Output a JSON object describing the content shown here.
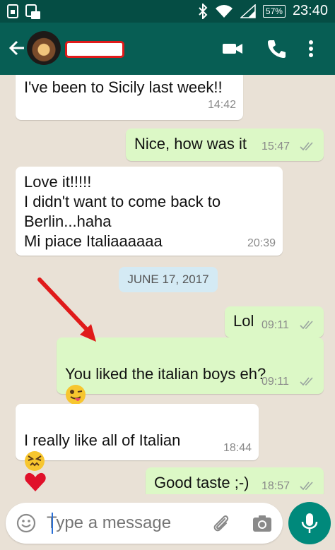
{
  "status_bar": {
    "battery": "57%",
    "time": "23:40"
  },
  "toolbar": {},
  "messages": [
    {
      "text": "I've been to Sicily last week!!",
      "time": "14:42"
    },
    {
      "text": "Nice, how was it",
      "time": "15:47"
    },
    {
      "text": "Love it!!!!!\nI didn't want to come back to\nBerlin...haha\nMi piace Italiaaaaaa",
      "time": "20:39"
    },
    {
      "text": "Lol",
      "time": "09:11"
    },
    {
      "text": "You liked the italian boys eh?",
      "time": "09:11"
    },
    {
      "text": "I really like all of Italian",
      "time": "18:44"
    },
    {
      "text": "Good taste ;-)",
      "time": "18:57"
    }
  ],
  "date_divider": "JUNE 17, 2017",
  "input": {
    "placeholder": "Type a message"
  },
  "colors": {
    "header": "#075e54",
    "status_bar": "#054d44",
    "outgoing_bubble": "#dcf8c6",
    "incoming_bubble": "#ffffff",
    "mic_button": "#00897b",
    "annotation_arrow": "#e01a1a"
  },
  "icons": [
    "sim-icon",
    "sd-card-icon",
    "bluetooth-icon",
    "wifi-icon",
    "signal-icon",
    "battery-icon",
    "back-arrow-icon",
    "video-call-icon",
    "phone-icon",
    "more-vert-icon",
    "double-check-icon",
    "emoji-icon",
    "attach-icon",
    "camera-icon",
    "mic-icon"
  ]
}
